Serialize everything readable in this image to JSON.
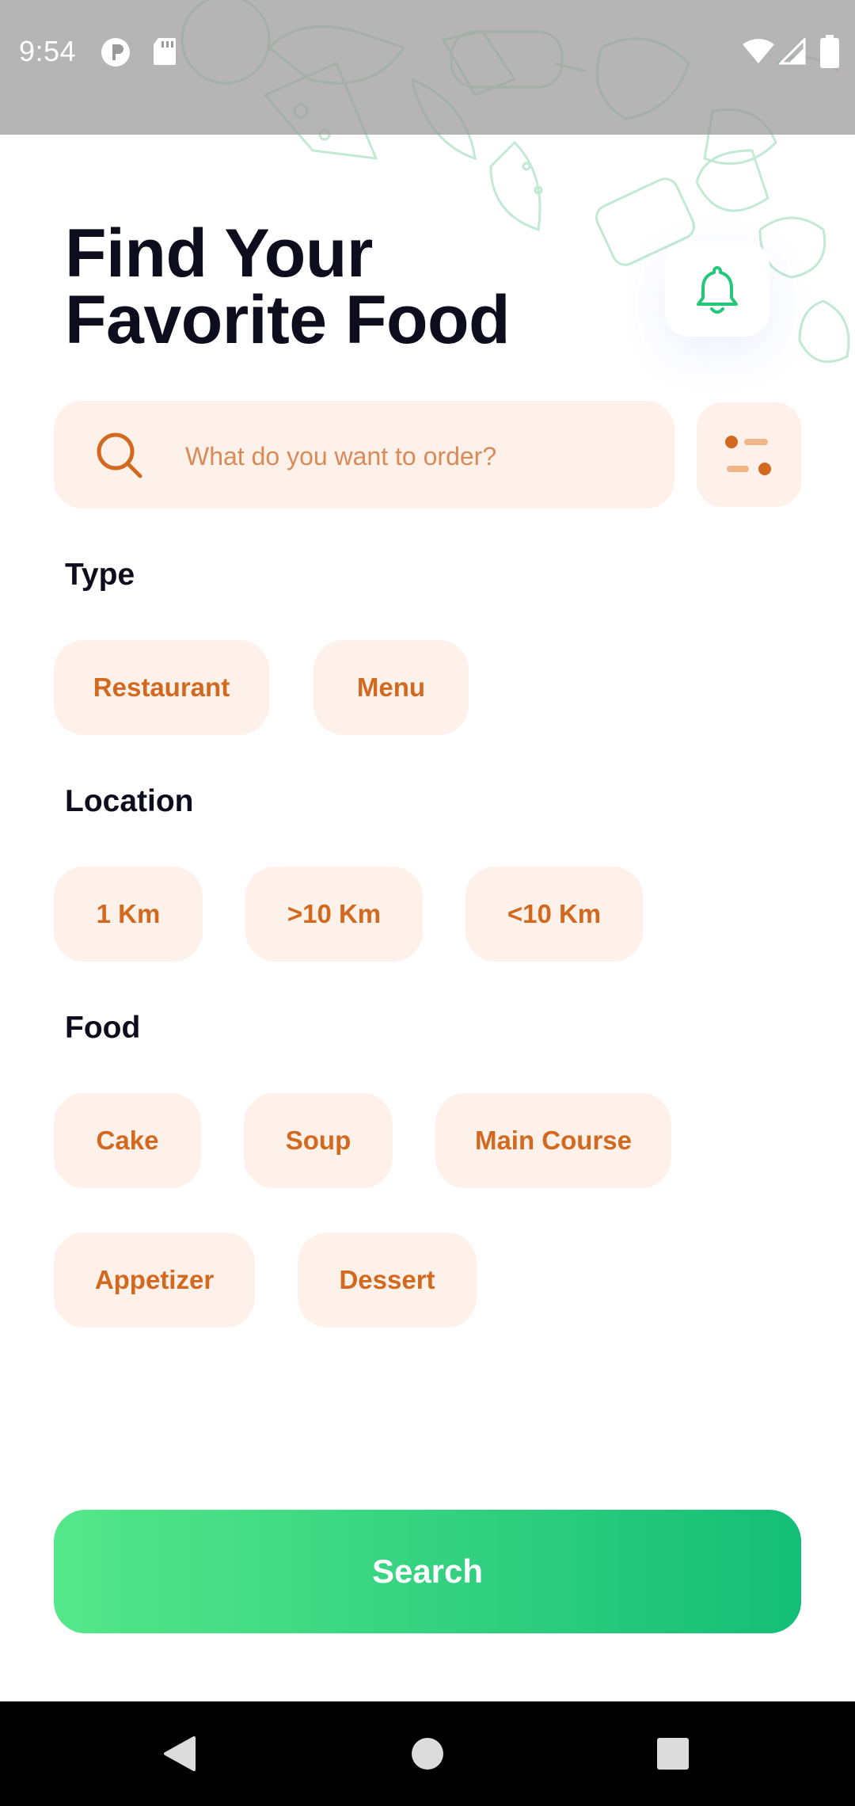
{
  "status_bar": {
    "time": "9:54"
  },
  "header": {
    "title_line1": "Find Your",
    "title_line2": "Favorite Food",
    "notification_icon": "bell-icon"
  },
  "search": {
    "placeholder": "What do you want to order?",
    "value": "",
    "filter_icon": "filter-icon"
  },
  "sections": {
    "type": {
      "label": "Type",
      "chips": [
        "Restaurant",
        "Menu"
      ]
    },
    "location": {
      "label": "Location",
      "chips": [
        "1 Km",
        ">10 Km",
        "<10 Km"
      ]
    },
    "food": {
      "label": "Food",
      "chips": [
        "Cake",
        "Soup",
        "Main Course",
        "Appetizer",
        "Dessert"
      ]
    }
  },
  "actions": {
    "search_label": "Search"
  },
  "colors": {
    "accent_green": "#15BE77",
    "accent_green_light": "#55E78B",
    "chip_bg": "#FDF1EA",
    "chip_text": "#D3691F",
    "heading": "#0D0D1E"
  }
}
